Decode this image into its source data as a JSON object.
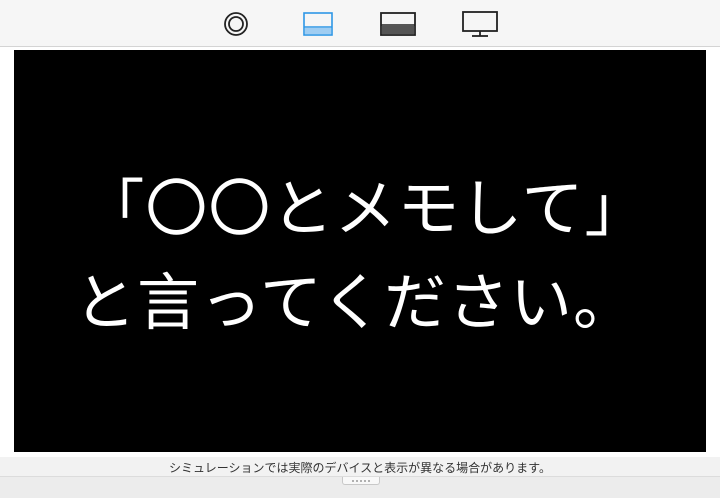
{
  "toolbar": {
    "buttons": [
      {
        "icon": "watch-icon",
        "selected": false
      },
      {
        "icon": "voice-panel-icon",
        "selected": true
      },
      {
        "icon": "display-panel-icon",
        "selected": false
      },
      {
        "icon": "tv-monitor-icon",
        "selected": false
      }
    ],
    "accent_color": "#2e97e6"
  },
  "screen": {
    "line1": "「〇〇とメモして」",
    "line2": "と言ってください。",
    "background": "#000000",
    "text_color": "#ffffff"
  },
  "notice": {
    "text": "シミュレーションでは実際のデバイスと表示が異なる場合があります。"
  }
}
